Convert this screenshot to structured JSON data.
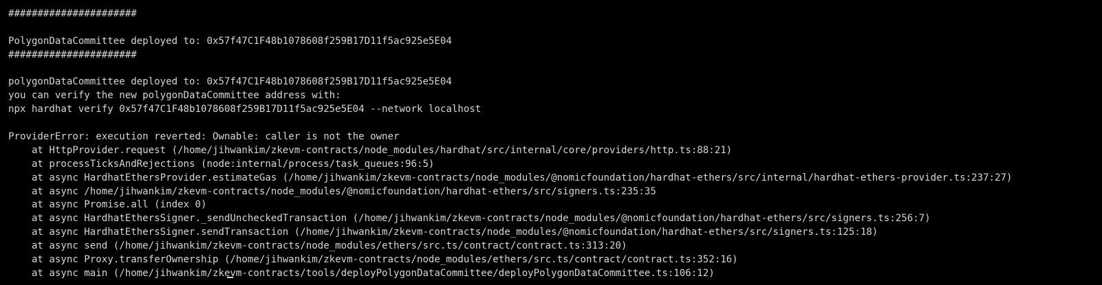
{
  "terminal": {
    "lines": [
      "######################",
      "",
      "PolygonDataCommittee deployed to: 0x57f47C1F48b1078608f259B17D11f5ac925e5E04",
      "######################",
      "",
      "polygonDataCommittee deployed to: 0x57f47C1F48b1078608f259B17D11f5ac925e5E04",
      "you can verify the new polygonDataCommittee address with:",
      "npx hardhat verify 0x57f47C1F48b1078608f259B17D11f5ac925e5E04 --network localhost",
      "",
      "ProviderError: execution reverted: Ownable: caller is not the owner",
      "    at HttpProvider.request (/home/jihwankim/zkevm-contracts/node_modules/hardhat/src/internal/core/providers/http.ts:88:21)",
      "    at processTicksAndRejections (node:internal/process/task_queues:96:5)",
      "    at async HardhatEthersProvider.estimateGas (/home/jihwankim/zkevm-contracts/node_modules/@nomicfoundation/hardhat-ethers/src/internal/hardhat-ethers-provider.ts:237:27)",
      "    at async /home/jihwankim/zkevm-contracts/node_modules/@nomicfoundation/hardhat-ethers/src/signers.ts:235:35",
      "    at async Promise.all (index 0)",
      "    at async HardhatEthersSigner._sendUncheckedTransaction (/home/jihwankim/zkevm-contracts/node_modules/@nomicfoundation/hardhat-ethers/src/signers.ts:256:7)",
      "    at async HardhatEthersSigner.sendTransaction (/home/jihwankim/zkevm-contracts/node_modules/@nomicfoundation/hardhat-ethers/src/signers.ts:125:18)",
      "    at async send (/home/jihwankim/zkevm-contracts/node_modules/ethers/src.ts/contract/contract.ts:313:20)",
      "    at async Proxy.transferOwnership (/home/jihwankim/zkevm-contracts/node_modules/ethers/src.ts/contract/contract.ts:352:16)",
      "    at async main (/home/jihwankim/zkevm-contracts/tools/deployPolygonDataCommittee/deployPolygonDataCommittee.ts:106:12)"
    ]
  }
}
